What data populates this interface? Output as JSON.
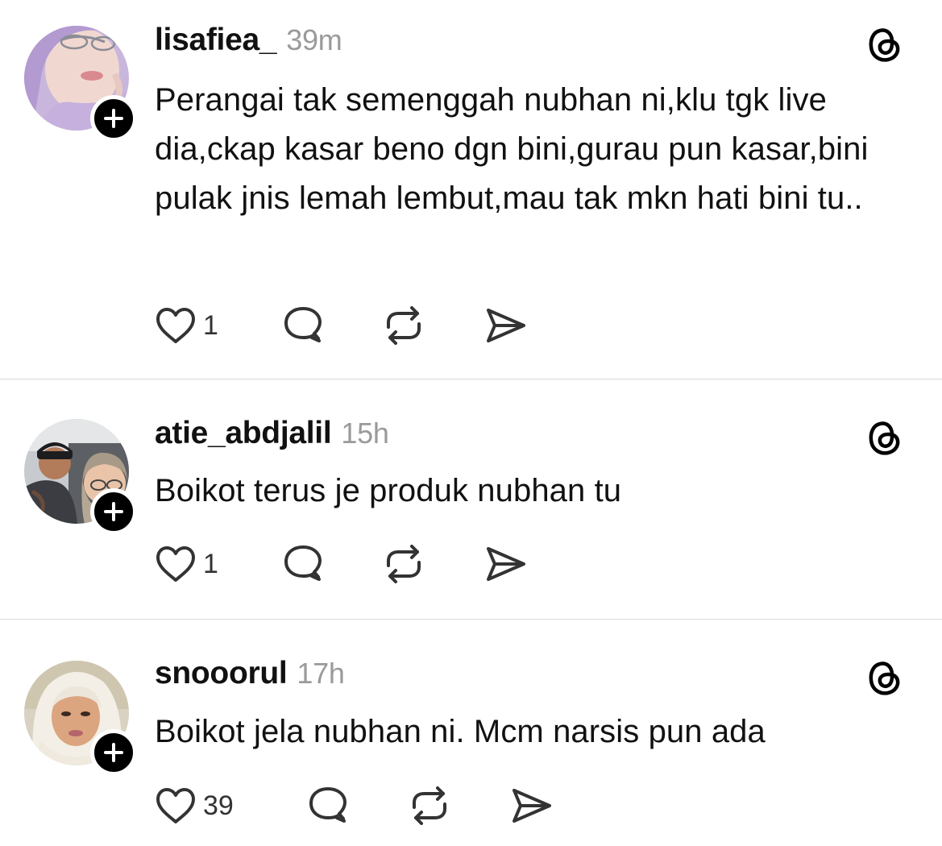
{
  "posts": [
    {
      "username": "lisafiea_",
      "time": "39m",
      "text": "Perangai tak semenggah nubhan ni,klu tgk live dia,ckap kasar beno dgn bini,gurau pun kasar,bini pulak jnis lemah lembut,mau tak mkn hati bini tu..",
      "likes": "1"
    },
    {
      "username": "atie_abdjalil",
      "time": "15h",
      "text": "Boikot terus je produk nubhan tu",
      "likes": "1"
    },
    {
      "username": "snooorul",
      "time": "17h",
      "text": "Boikot jela nubhan ni. Mcm narsis pun ada",
      "likes": "39"
    }
  ],
  "icons": {
    "follow": "plus-icon",
    "app": "threads-logo-icon",
    "like": "heart-icon",
    "reply": "comment-bubble-icon",
    "repost": "repost-icon",
    "share": "send-icon"
  },
  "colors": {
    "text": "#111111",
    "timestamp": "#9a9a9a",
    "divider": "#dbdbdb",
    "badge": "#000000"
  }
}
